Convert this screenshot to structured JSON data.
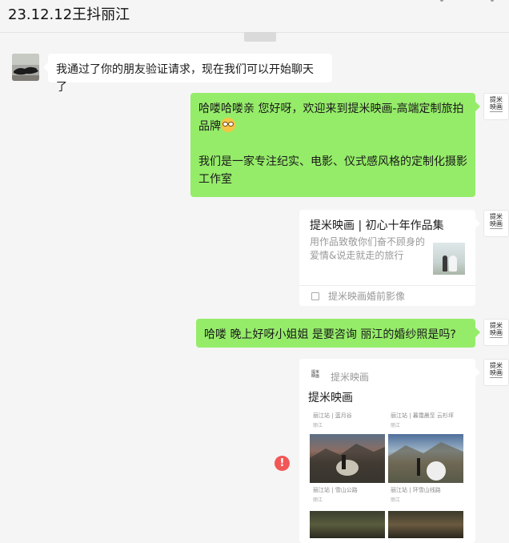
{
  "header": {
    "title": "23.12.12王抖丽江"
  },
  "timestamp": "",
  "messages": {
    "m1": {
      "text": "我通过了你的朋友验证请求，现在我们可以开始聊天了"
    },
    "m2": {
      "line1": "哈喽哈喽亲 您好呀，欢迎来到提米映画-高端定制旅拍品牌",
      "line2": "我们是一家专注纪实、电影、仪式感风格的定制化摄影工作室"
    },
    "m3": {
      "title": "提米映画 | 初心十年作品集",
      "desc": "用作品致敬你们奋不顾身的爱情&说走就走的旅行",
      "source": "提米映画婚前影像"
    },
    "m4": {
      "text": "哈喽  晚上好呀小姐姐 是要咨询  丽江的婚纱照是吗?"
    },
    "m5": {
      "source": "提米映画",
      "title": "提米映画",
      "items": [
        {
          "sub": "丽江站 | 蓝月谷",
          "place": "丽江"
        },
        {
          "sub": "丽江站 | 暮霭晨至 云杉坪",
          "place": "丽江"
        },
        {
          "sub": "丽江站 | 雪山公路",
          "place": "丽江"
        },
        {
          "sub": "丽江站 | 环雪山线路",
          "place": "丽江"
        }
      ]
    }
  },
  "avatar_logo": {
    "line1": "提米",
    "line2": "映画"
  },
  "alert": "!",
  "colors": {
    "green_bubble": "#95ec69",
    "background": "#f5f5f5",
    "alert": "#f25757"
  }
}
